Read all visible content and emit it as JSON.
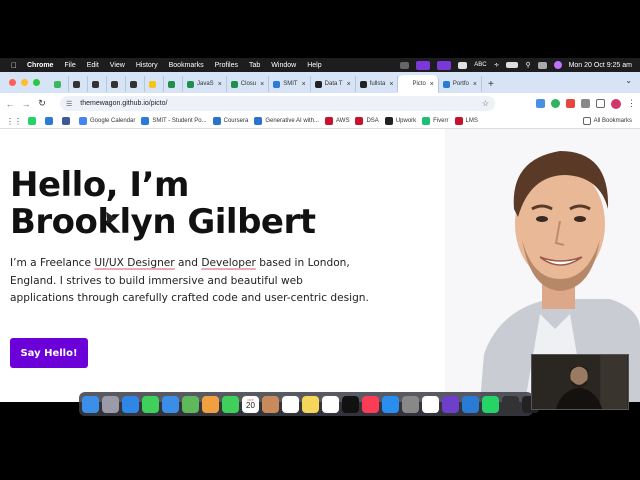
{
  "menubar": {
    "app": "Chrome",
    "items": [
      "File",
      "Edit",
      "View",
      "History",
      "Bookmarks",
      "Profiles",
      "Tab",
      "Window",
      "Help"
    ],
    "input_source": "ABC",
    "clock": "Mon 20 Oct  9:25 am"
  },
  "tabs": [
    {
      "label": "",
      "fav_color": "#3bb85d"
    },
    {
      "label": "",
      "fav_color": "#333"
    },
    {
      "label": "",
      "fav_color": "#333"
    },
    {
      "label": "",
      "fav_color": "#333"
    },
    {
      "label": "",
      "fav_color": "#333"
    },
    {
      "label": "",
      "fav_color": "#f5c518"
    },
    {
      "label": "",
      "fav_color": "#1f8f4f"
    },
    {
      "label": "JavaS",
      "fav_color": "#1f8f4f"
    },
    {
      "label": "Closu",
      "fav_color": "#1f8f4f"
    },
    {
      "label": "SMIT",
      "fav_color": "#2b7bd6"
    },
    {
      "label": "Data T",
      "fav_color": "#222"
    },
    {
      "label": "fullsta",
      "fav_color": "#222"
    },
    {
      "label": "Picto",
      "fav_color": "#fff",
      "active": true
    },
    {
      "label": "Portfo",
      "fav_color": "#2b7bd6"
    }
  ],
  "toolbar": {
    "url": "themewagon.github.io/picto/"
  },
  "bookmarks": {
    "items": [
      {
        "label": "",
        "color": "#25d366"
      },
      {
        "label": "",
        "color": "#2b7bd6"
      },
      {
        "label": "",
        "color": "#3d5a98"
      },
      {
        "label": "Google Calendar",
        "color": "#4285f4"
      },
      {
        "label": "SMIT - Student Po...",
        "color": "#2b7bd6"
      },
      {
        "label": "Coursera",
        "color": "#2a73cc"
      },
      {
        "label": "Generative AI with...",
        "color": "#2a73cc"
      },
      {
        "label": "AWS",
        "color": "#c4122f"
      },
      {
        "label": "DSA",
        "color": "#c4122f"
      },
      {
        "label": "Upwork",
        "color": "#222"
      },
      {
        "label": "Fiverr",
        "color": "#1dbf73"
      },
      {
        "label": "LMS",
        "color": "#c4122f"
      }
    ],
    "all": "All Bookmarks"
  },
  "hero": {
    "line1": "Hello, I’m",
    "line2": "Brooklyn Gilbert",
    "intro_a": "I’m a Freelance ",
    "intro_hl1": "UI/UX Designer",
    "intro_b": " and ",
    "intro_hl2": "Developer",
    "intro_c": " based in London, England. I strives to build immersive and beautiful web applications through carefully crafted code and user-centric design.",
    "cta": "Say Hello!",
    "accent": "#6b00d8"
  },
  "dock": {
    "calendar_day": "20",
    "calendar_month": "OCT",
    "apps": [
      "finder-icon",
      "launchpad-icon",
      "safari-icon",
      "messages-icon",
      "mail-icon",
      "maps-icon",
      "photos-icon",
      "facetime-icon",
      "calendar-icon",
      "contacts-icon",
      "reminders-icon",
      "notes-icon",
      "freeform-icon",
      "tv-icon",
      "music-icon",
      "appstore-icon",
      "settings-icon",
      "chrome-icon",
      "github-icon",
      "vscode-icon",
      "whatsapp-icon",
      "camera-icon",
      "activity-icon"
    ]
  }
}
